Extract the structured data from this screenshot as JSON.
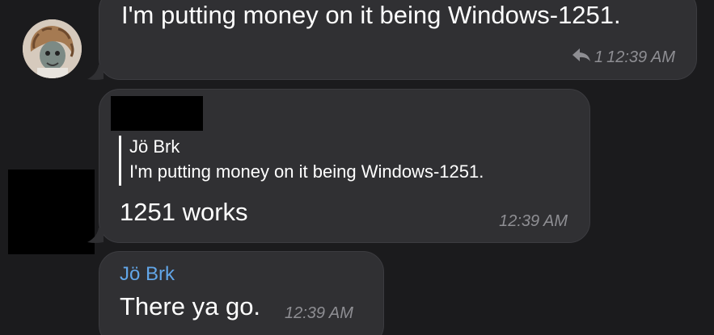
{
  "messages": [
    {
      "text": "I'm putting money on it being Windows-1251.",
      "reply_count": "1",
      "time": "12:39 AM"
    },
    {
      "reply": {
        "name": "Jö Brk",
        "text": "I'm putting money on it being Windows-1251."
      },
      "text": "1251 works",
      "time": "12:39 AM"
    },
    {
      "sender": "Jö Brk",
      "text": "There ya go.",
      "time": "12:39 AM"
    }
  ],
  "colors": {
    "background": "#1b1b1d",
    "bubble": "#303033",
    "sender_name": "#62a6e8",
    "timestamp": "#8e8e93"
  },
  "icons": {
    "reply": "reply-arrow-icon"
  }
}
